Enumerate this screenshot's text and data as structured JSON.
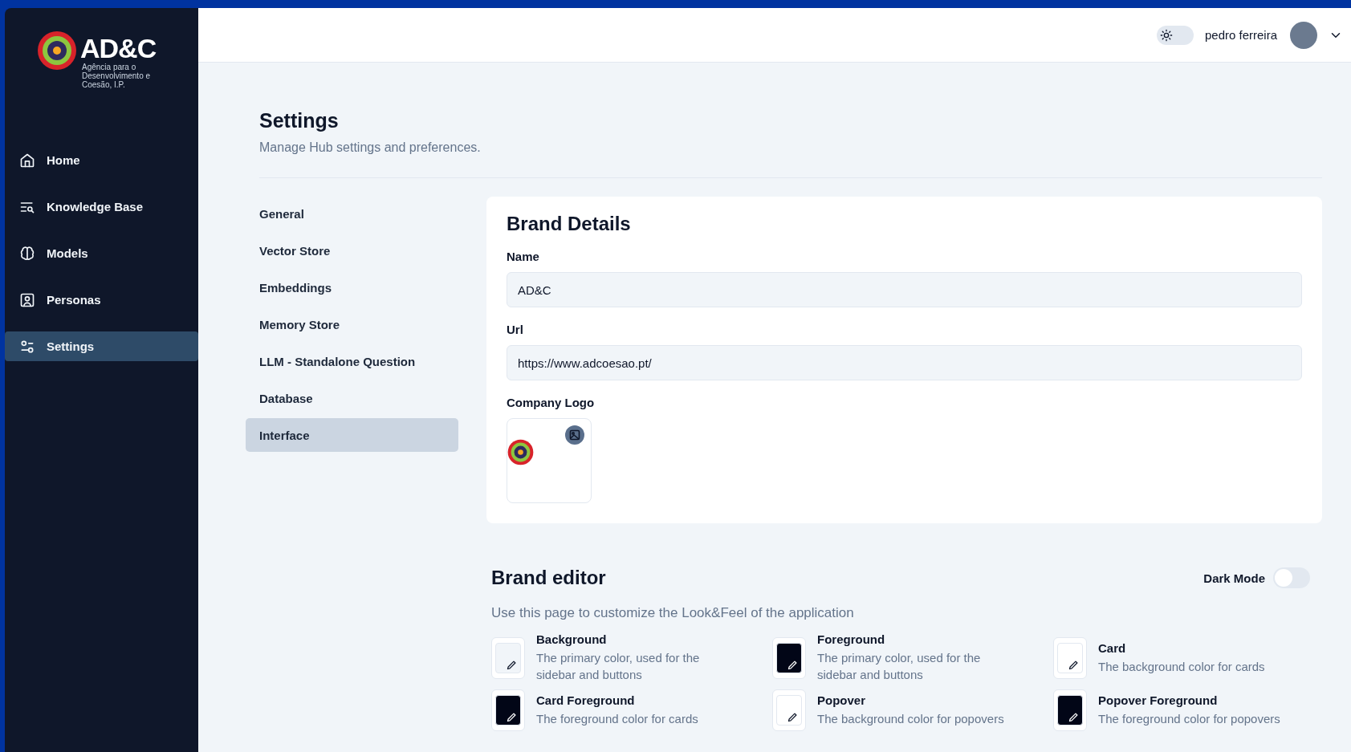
{
  "brand": {
    "name": "AD&C",
    "tagline": "Agência para o Desenvolvimento e Coesão, I.P."
  },
  "sidebar": {
    "items": [
      {
        "label": "Home",
        "selected": false
      },
      {
        "label": "Knowledge Base",
        "selected": false
      },
      {
        "label": "Models",
        "selected": false
      },
      {
        "label": "Personas",
        "selected": false
      },
      {
        "label": "Settings",
        "selected": true
      }
    ]
  },
  "header": {
    "theme_toggle": {
      "on": false
    },
    "user": "pedro ferreira"
  },
  "page": {
    "title": "Settings",
    "subtitle": "Manage Hub settings and preferences."
  },
  "settings_nav": [
    {
      "label": "General",
      "selected": false
    },
    {
      "label": "Vector Store",
      "selected": false
    },
    {
      "label": "Embeddings",
      "selected": false
    },
    {
      "label": "Memory Store",
      "selected": false
    },
    {
      "label": "LLM - Standalone Question",
      "selected": false
    },
    {
      "label": "Database",
      "selected": false
    },
    {
      "label": "Interface",
      "selected": true
    }
  ],
  "brand_details": {
    "title": "Brand Details",
    "fields": [
      {
        "label": "Name",
        "value": "AD&C"
      },
      {
        "label": "Url",
        "value": "https://www.adcoesao.pt/"
      }
    ],
    "logo_label": "Company Logo"
  },
  "brand_editor": {
    "title": "Brand editor",
    "dark_mode": {
      "label": "Dark Mode",
      "on": false
    },
    "description": "Use this page to customize the Look&Feel of the application",
    "colors": [
      {
        "name": "Background",
        "description": "The primary color, used for the sidebar and buttons",
        "color": "#f1f5f9"
      },
      {
        "name": "Foreground",
        "description": "The primary color, used for the sidebar and buttons",
        "color": "#020617"
      },
      {
        "name": "Card",
        "description": "The background color for cards",
        "color": "#ffffff"
      },
      {
        "name": "Card Foreground",
        "description": "The foreground color for cards",
        "color": "#020617"
      },
      {
        "name": "Popover",
        "description": "The background color for popovers",
        "color": "#ffffff"
      },
      {
        "name": "Popover Foreground",
        "description": "The foreground color for popovers",
        "color": "#020617"
      }
    ]
  }
}
